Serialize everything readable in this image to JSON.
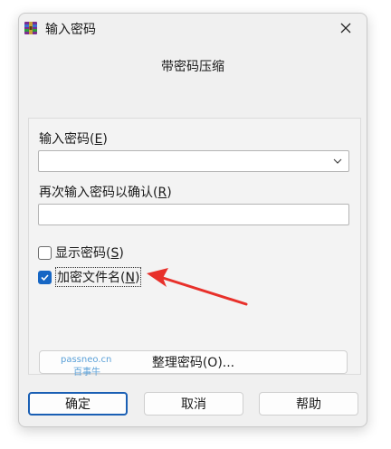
{
  "window": {
    "title": "输入密码",
    "heading": "带密码压缩"
  },
  "fields": {
    "password_label": "输入密码(",
    "password_accel": "E",
    "password_label_end": ")",
    "password_value": "",
    "confirm_label": "再次输入密码以确认(",
    "confirm_accel": "R",
    "confirm_label_end": ")",
    "confirm_value": ""
  },
  "options": {
    "show_password_label": "显示密码(",
    "show_password_accel": "S",
    "show_password_end": ")",
    "show_password_checked": false,
    "encrypt_names_label": "加密文件名(",
    "encrypt_names_accel": "N",
    "encrypt_names_end": ")",
    "encrypt_names_checked": true
  },
  "organize_button": "整理密码(O)...",
  "watermark": {
    "line1": "passneo.cn",
    "line2": "百事牛"
  },
  "buttons": {
    "ok": "确定",
    "cancel": "取消",
    "help": "帮助"
  },
  "colors": {
    "accent": "#1666c4",
    "annotation_arrow": "#e8302a"
  }
}
